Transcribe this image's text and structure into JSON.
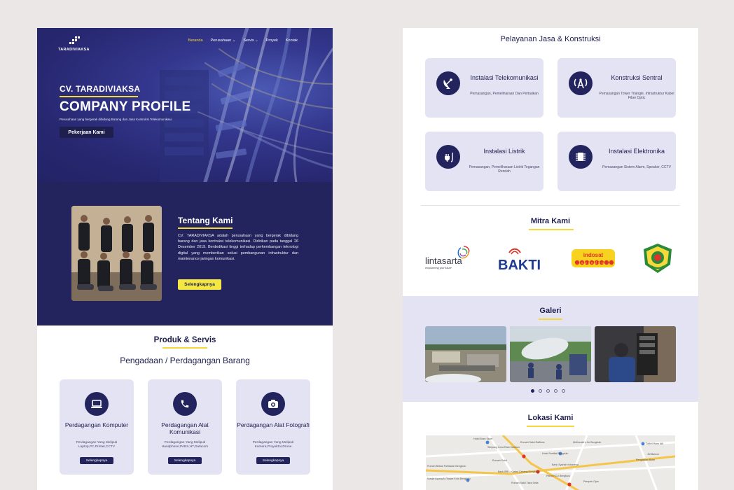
{
  "nav": {
    "logo_text": "TARADIVIAKSA",
    "items": [
      {
        "label": "Beranda",
        "active": true
      },
      {
        "label": "Perusahaan ⌄",
        "active": false
      },
      {
        "label": "Servis ⌄",
        "active": false
      },
      {
        "label": "Proyek",
        "active": false
      },
      {
        "label": "Kontak",
        "active": false
      }
    ]
  },
  "hero": {
    "subtitle": "CV. TARADIVIAKSA",
    "title": "COMPANY PROFILE",
    "description": "Perusahaan yang bergerak dibidang Barang dan Jasa Kontruksi Telekomunikasi.",
    "button": "Pekerjaan Kami"
  },
  "about": {
    "title": "Tentang Kami",
    "text": "CV. TARADIVIAKSA adalah perusahaan yang bergerak dibidang barang dan jasa kontruksi telekomunikasi. Didirikan pada tanggal 26 Desember 2019. Berdedikasi tinggi terhadap perkembangan teknologi digital yang memberikan solusi pembangunan infrastruktur dan maintenance jaringan komunikasi.",
    "button": "Selengkapnya"
  },
  "produk": {
    "title": "Produk & Servis",
    "subtitle": "Pengadaan / Perdagangan Barang",
    "cards": [
      {
        "icon": "laptop-icon",
        "title": "Perdagangan Komputer",
        "desc": "Perdagangan Yang Meliputi Laptop,PC,Printer,CCTV",
        "button": "Selengkapnya"
      },
      {
        "icon": "phone-icon",
        "title": "Perdagangan Alat Komunikasi",
        "desc": "Perdagangan Yang Meliputi Handphone,PABX,HT,Datacom",
        "button": "Selengkapnya"
      },
      {
        "icon": "camera-icon",
        "title": "Perdagangan Alat Fotografi",
        "desc": "Perdagangan Yang Meliputi Kamera,Proyektor,Drone",
        "button": "Selengkapnya"
      }
    ]
  },
  "pelayanan": {
    "title": "Pelayanan Jasa & Konstruksi",
    "cards": [
      {
        "icon": "satellite-dish-icon",
        "title": "Instalasi Telekomunikasi",
        "desc": "Pemasangan, Pemeliharaan Dan Perbaikan"
      },
      {
        "icon": "antenna-icon",
        "title": "Konstruksi Sentral",
        "desc": "Pemasangan Tower Triangle, Infrastruktur Kabel Fiber Optic"
      },
      {
        "icon": "plug-icon",
        "title": "Instalasi Listrik",
        "desc": "Pemasangan, Pemeliharaan Listrik Tegangan Rendah"
      },
      {
        "icon": "chip-icon",
        "title": "Instalasi Elektronika",
        "desc": "Pemasangan Sistem Alarm, Speaker, CCTV"
      }
    ]
  },
  "mitra": {
    "title": "Mitra Kami",
    "partners": [
      {
        "name": "lintasarta",
        "tagline": "empowering your future"
      },
      {
        "name": "BAKTI"
      },
      {
        "name": "indosat ooredoo",
        "line1": "indosat",
        "line2": "ooredoo"
      },
      {
        "name": "seal-logo"
      }
    ]
  },
  "galeri": {
    "title": "Galeri",
    "slides": 5,
    "active_slide": 1
  },
  "lokasi": {
    "title": "Lokasi Kami",
    "map_labels": [
      "Hotel Bose Sport",
      "Rumah Sakit Raffless",
      "McDonald's Jln Bengkulu",
      "Dafori Huen Alfi",
      "Simpang Lima Ratu Samban",
      "Hotel Santika Bengkulu",
      "JM Balmor",
      "Pengadilan Bose",
      "Rumah Bekas Pahlawan Bengkulu",
      "Rumah Sukit",
      "Bank Syariah Indonesia",
      "Bank BRI - Kantor Cabang Bengkulu",
      "Patria KCU Bengkulu",
      "Masjid Agung At-Taqwa Kota Bengkulu",
      "Rumah Sakit Tiara Sella",
      "Pempek Ojan"
    ]
  },
  "colors": {
    "navy": "#23235e",
    "yellow": "#f5d93a",
    "card": "#e3e3f3"
  }
}
